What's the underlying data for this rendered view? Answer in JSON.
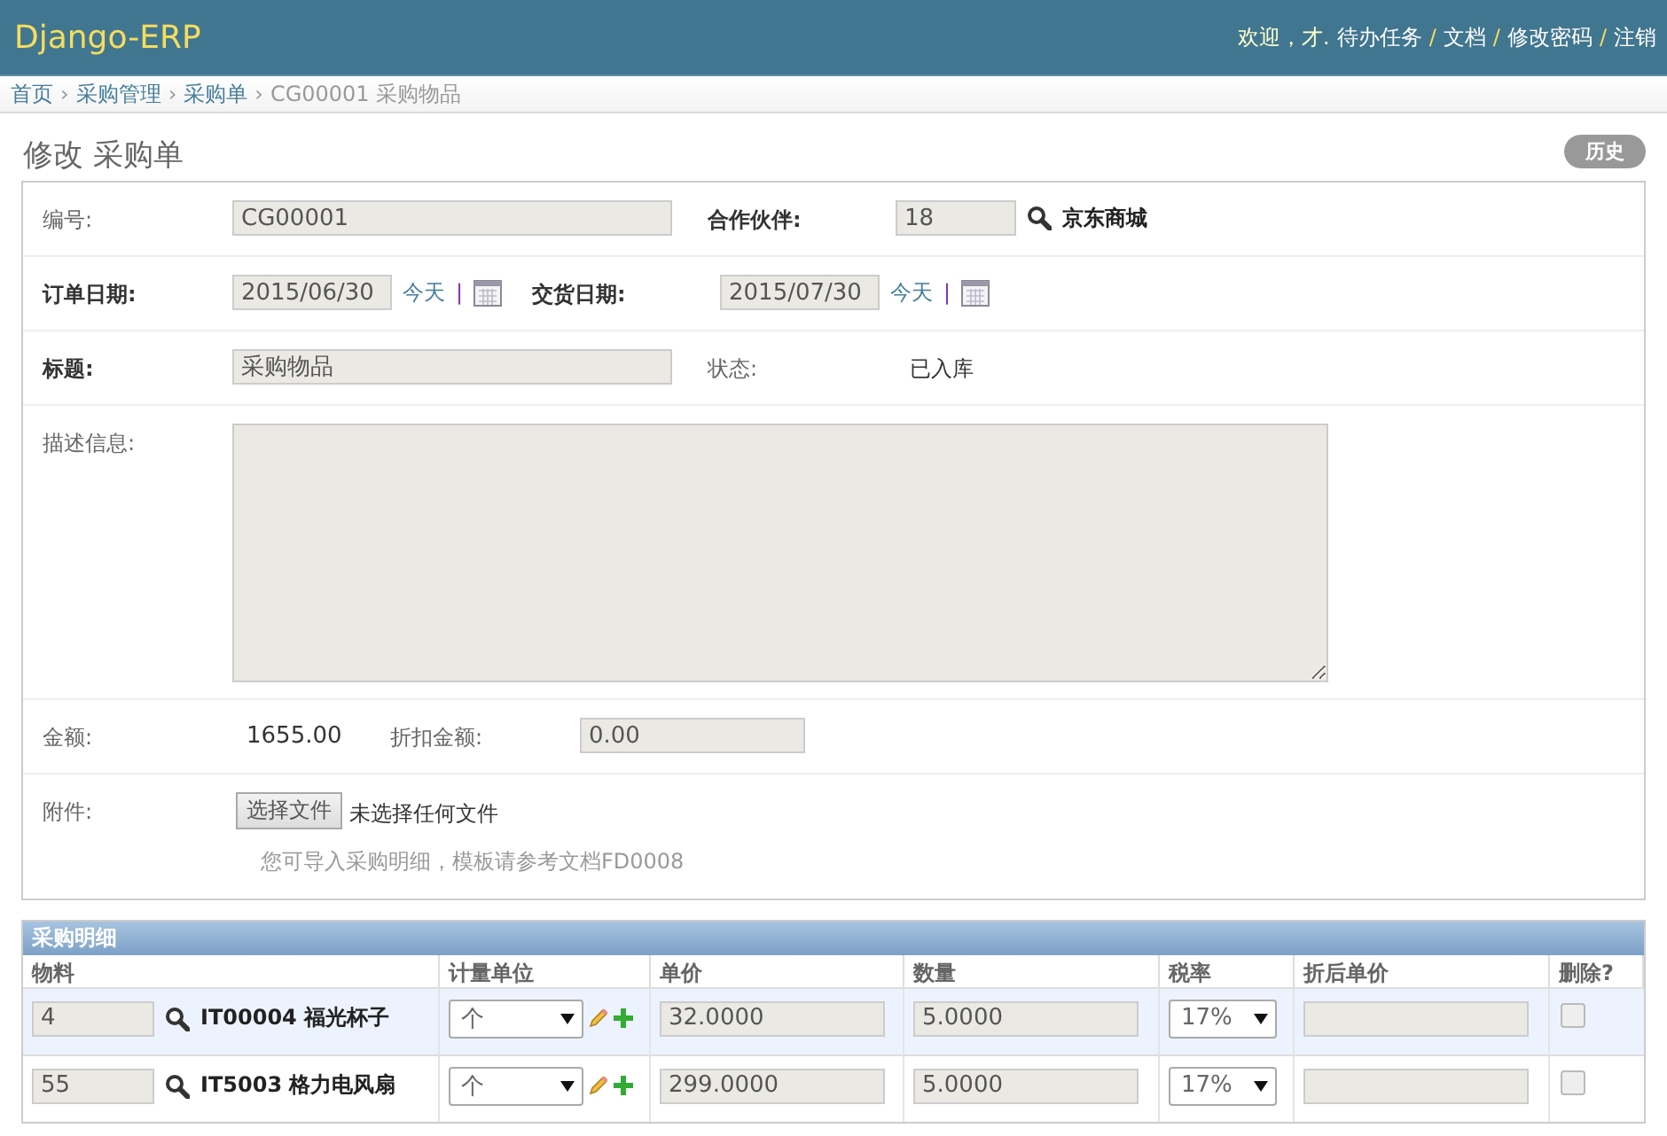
{
  "header": {
    "brand": "Django-ERP",
    "welcome": "欢迎，才.",
    "separator": "/",
    "links": [
      "待办任务",
      "文档",
      "修改密码",
      "注销"
    ]
  },
  "breadcrumbs": {
    "separator": "›",
    "links": [
      "首页",
      "采购管理",
      "采购单"
    ],
    "current": "CG00001 采购物品"
  },
  "page": {
    "title": "修改 采购单",
    "history_button": "历史"
  },
  "form_rows": [
    {
      "kind": "pair",
      "label": "编号:",
      "label_bold": false,
      "value": "CG00001",
      "label2": "合作伙伴:",
      "label2_bold": true,
      "value2": "18",
      "lookup_text": "京东商城"
    },
    {
      "kind": "dates",
      "label": "订单日期:",
      "label_bold": true,
      "value": "2015/06/30",
      "today": "今天",
      "separator": "|",
      "label2": "交货日期:",
      "label2_bold": true,
      "value2": "2015/07/30",
      "today2": "今天",
      "separator2": "|"
    },
    {
      "kind": "status",
      "label": "标题:",
      "label_bold": true,
      "value": "采购物品",
      "label2": "状态:",
      "label2_bold": false,
      "text2": "已入库"
    },
    {
      "kind": "textarea",
      "label": "描述信息:",
      "label_bold": false
    },
    {
      "kind": "amounts",
      "label": "金额:",
      "label_bold": false,
      "text": "1655.00",
      "label2": "折扣金额:",
      "label2_bold": false,
      "value2": "0.00"
    },
    {
      "kind": "file",
      "label": "附件:",
      "label_bold": false,
      "button": "选择文件",
      "file_status": "未选择任何文件",
      "help": "您可导入采购明细，模板请参考文档FD0008"
    }
  ],
  "items_table": {
    "title": "采购明细",
    "columns": [
      "物料",
      "计量单位",
      "单价",
      "数量",
      "税率",
      "折后单价",
      "删除?"
    ],
    "rows": [
      {
        "material_id": "4",
        "material_name": "IT00004 福光杯子",
        "unit": "个",
        "price": "32.0000",
        "quantity": "5.0000",
        "tax": "17%",
        "delete_checked": false
      },
      {
        "material_id": "55",
        "material_name": "IT5003 格力电风扇",
        "unit": "个",
        "price": "299.0000",
        "quantity": "5.0000",
        "tax": "17%",
        "delete_checked": false
      }
    ]
  }
}
